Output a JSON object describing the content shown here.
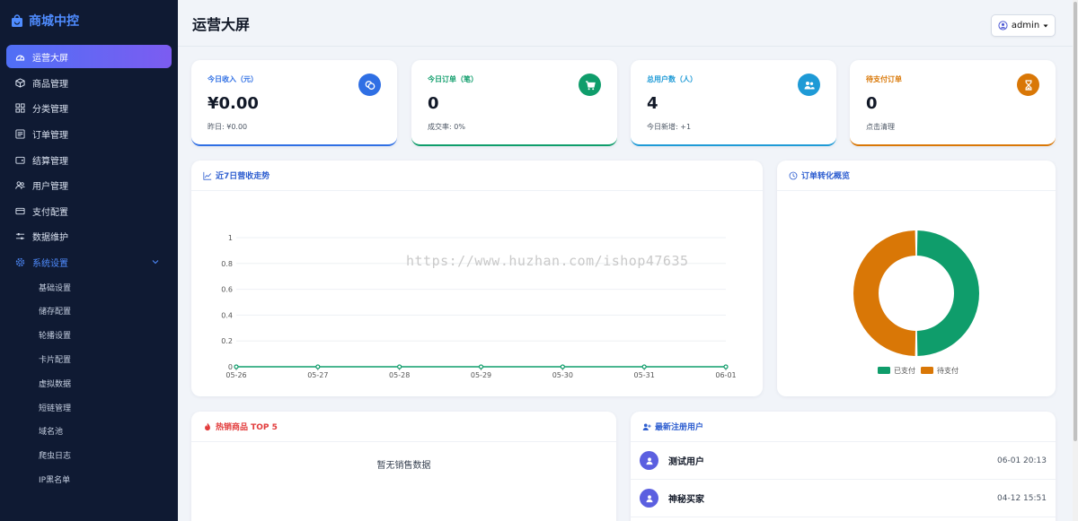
{
  "brand": {
    "name": "商城中控"
  },
  "nav": {
    "items": [
      {
        "label": "运营大屏",
        "icon": "dashboard-icon"
      },
      {
        "label": "商品管理",
        "icon": "box-icon"
      },
      {
        "label": "分类管理",
        "icon": "grid-icon"
      },
      {
        "label": "订单管理",
        "icon": "list-icon"
      },
      {
        "label": "结算管理",
        "icon": "wallet-icon"
      },
      {
        "label": "用户管理",
        "icon": "users-icon"
      },
      {
        "label": "支付配置",
        "icon": "card-icon"
      },
      {
        "label": "数据维护",
        "icon": "sliders-icon"
      },
      {
        "label": "系统设置",
        "icon": "gear-icon"
      }
    ],
    "sub_items": [
      "基础设置",
      "储存配置",
      "轮播设置",
      "卡片配置",
      "虚拟数据",
      "短链管理",
      "域名池",
      "爬虫日志",
      "IP黑名单"
    ]
  },
  "header": {
    "title": "运营大屏",
    "user": "admin"
  },
  "stats": [
    {
      "label": "今日收入（元）",
      "value": "¥0.00",
      "sub": "昨日: ¥0.00",
      "color": "#2f6fe4",
      "icon": "coins-icon"
    },
    {
      "label": "今日订单（笔）",
      "value": "0",
      "sub": "成交率: 0%",
      "color": "#0f9d6b",
      "icon": "cart-icon"
    },
    {
      "label": "总用户数（人）",
      "value": "4",
      "sub": "今日新增: +1",
      "color": "#1e9ad6",
      "icon": "users-icon"
    },
    {
      "label": "待支付订单",
      "value": "0",
      "sub": "点击清理",
      "color": "#d97706",
      "icon": "hourglass-icon"
    }
  ],
  "revenue_panel": {
    "title": "近7日营收走势"
  },
  "conversion_panel": {
    "title": "订单转化概览"
  },
  "hot_panel": {
    "title": "热销商品 TOP 5",
    "empty": "暂无销售数据"
  },
  "new_users_panel": {
    "title": "最新注册用户",
    "rows": [
      {
        "name": "测试用户",
        "time": "06-01 20:13"
      },
      {
        "name": "神秘买家",
        "time": "04-12 15:51"
      }
    ]
  },
  "watermark": "https://www.huzhan.com/ishop47635",
  "chart_data": [
    {
      "type": "line",
      "categories": [
        "05-26",
        "05-27",
        "05-28",
        "05-29",
        "05-30",
        "05-31",
        "06-01"
      ],
      "values": [
        0,
        0,
        0,
        0,
        0,
        0,
        0
      ],
      "ylim": [
        0,
        1
      ],
      "yticks": [
        "1",
        "0.8",
        "0.6",
        "0.4",
        "0.2",
        "0"
      ],
      "grid": true,
      "color": "#0f9d6b"
    },
    {
      "type": "pie",
      "donut": true,
      "labels": [
        "已支付",
        "待支付"
      ],
      "values": [
        50,
        50
      ],
      "colors": [
        "#0f9d6b",
        "#d97706"
      ],
      "legend": "bottom"
    }
  ]
}
